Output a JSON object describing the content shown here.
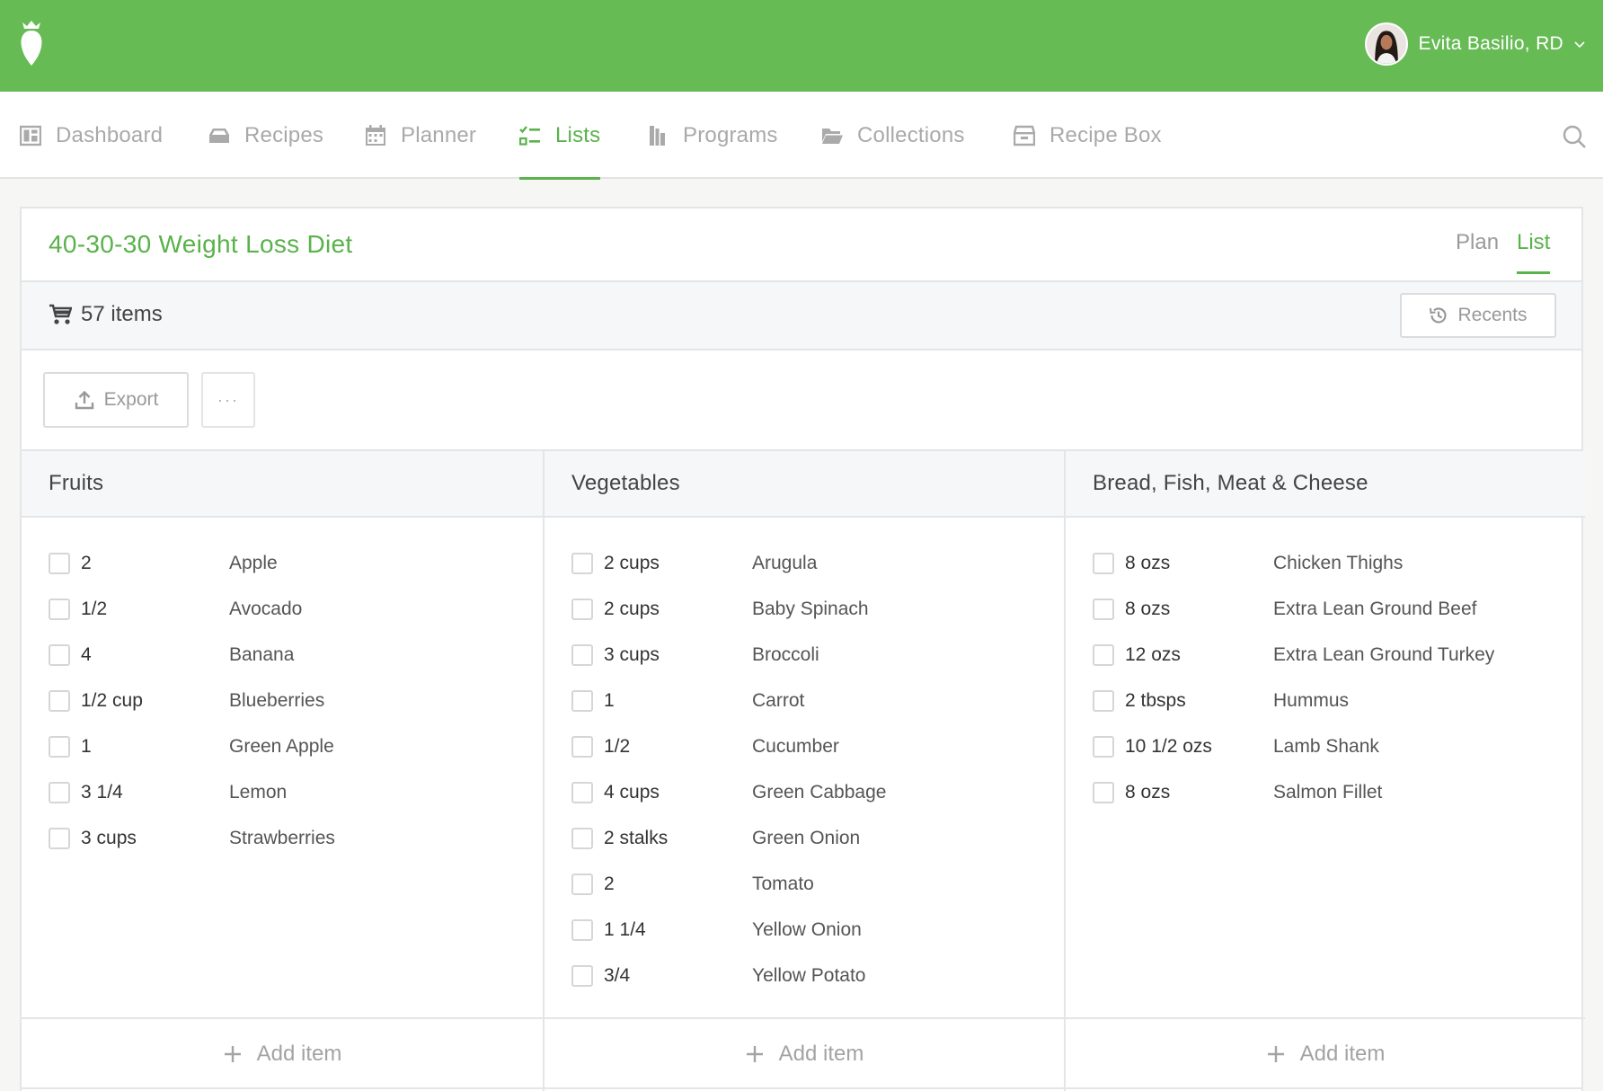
{
  "user": {
    "name": "Evita Basilio, RD"
  },
  "nav": {
    "items": [
      {
        "label": "Dashboard",
        "icon": "dashboard-icon"
      },
      {
        "label": "Recipes",
        "icon": "recipes-icon"
      },
      {
        "label": "Planner",
        "icon": "calendar-icon"
      },
      {
        "label": "Lists",
        "icon": "checklist-icon",
        "active": true
      },
      {
        "label": "Programs",
        "icon": "programs-icon"
      },
      {
        "label": "Collections",
        "icon": "folder-icon"
      },
      {
        "label": "Recipe Box",
        "icon": "box-icon"
      }
    ]
  },
  "plan": {
    "title": "40-30-30 Weight Loss Diet",
    "tabs": [
      {
        "label": "Plan"
      },
      {
        "label": "List",
        "active": true
      }
    ],
    "item_count": "57 items",
    "recents_label": "Recents",
    "export_label": "Export",
    "more_label": "···"
  },
  "columns": [
    {
      "title": "Fruits",
      "add_label": "Add item",
      "items": [
        {
          "qty": "2",
          "name": "Apple"
        },
        {
          "qty": "1/2",
          "name": "Avocado"
        },
        {
          "qty": "4",
          "name": "Banana"
        },
        {
          "qty": "1/2 cup",
          "name": "Blueberries"
        },
        {
          "qty": "1",
          "name": "Green Apple"
        },
        {
          "qty": "3 1/4",
          "name": "Lemon"
        },
        {
          "qty": "3 cups",
          "name": "Strawberries"
        }
      ]
    },
    {
      "title": "Vegetables",
      "add_label": "Add item",
      "items": [
        {
          "qty": "2 cups",
          "name": "Arugula"
        },
        {
          "qty": "2 cups",
          "name": "Baby Spinach"
        },
        {
          "qty": "3 cups",
          "name": "Broccoli"
        },
        {
          "qty": "1",
          "name": "Carrot"
        },
        {
          "qty": "1/2",
          "name": "Cucumber"
        },
        {
          "qty": "4 cups",
          "name": "Green Cabbage"
        },
        {
          "qty": "2 stalks",
          "name": "Green Onion"
        },
        {
          "qty": "2",
          "name": "Tomato"
        },
        {
          "qty": "1 1/4",
          "name": "Yellow Onion"
        },
        {
          "qty": "3/4",
          "name": "Yellow Potato"
        }
      ]
    },
    {
      "title": "Bread, Fish, Meat & Cheese",
      "add_label": "Add item",
      "items": [
        {
          "qty": "8 ozs",
          "name": "Chicken Thighs"
        },
        {
          "qty": "8 ozs",
          "name": "Extra Lean Ground Beef"
        },
        {
          "qty": "12 ozs",
          "name": "Extra Lean Ground Turkey"
        },
        {
          "qty": "2 tbsps",
          "name": "Hummus"
        },
        {
          "qty": "10 1/2 ozs",
          "name": "Lamb Shank"
        },
        {
          "qty": "8 ozs",
          "name": "Salmon Fillet"
        }
      ]
    }
  ],
  "colors": {
    "brand": "#66bb55",
    "accent": "#59b24a"
  }
}
